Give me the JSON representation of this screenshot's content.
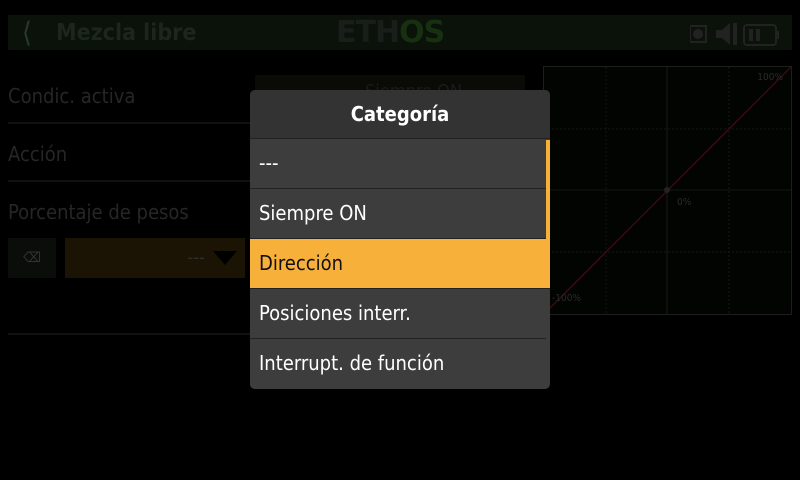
{
  "header": {
    "title": "Mezcla libre",
    "logo": "ETHOS",
    "back_icon": "chevron-left-icon"
  },
  "form": {
    "rows": [
      {
        "label": "Condic. activa",
        "value": "Siempre ON"
      },
      {
        "label": "Acción"
      },
      {
        "label": "Porcentaje de pesos"
      }
    ],
    "weight_field": {
      "clear_icon": "x-icon",
      "value": "---"
    }
  },
  "graph": {
    "labels": {
      "max": "100%",
      "mid": "0%",
      "min": "-100%"
    },
    "line_color": "#4a0a14"
  },
  "dialog": {
    "title": "Categoría",
    "items": [
      "---",
      "Siempre ON",
      "Dirección",
      "Posiciones interr.",
      "Interrupt. de función"
    ],
    "selected": "Dirección",
    "accent": "#f7b03a"
  }
}
